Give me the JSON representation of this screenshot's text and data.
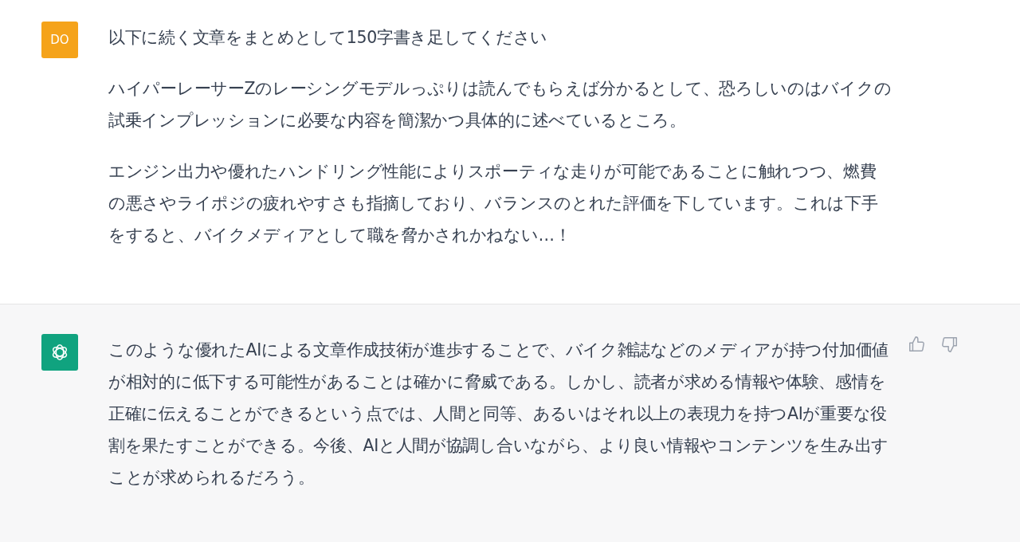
{
  "messages": [
    {
      "kind": "user",
      "avatar": "DO",
      "paragraphs": [
        "以下に続く文章をまとめとして150字書き足してください",
        "ハイパーレーサーZのレーシングモデルっぷりは読んでもらえば分かるとして、恐ろしいのはバイクの試乗インプレッションに必要な内容を簡潔かつ具体的に述べているところ。",
        "エンジン出力や優れたハンドリング性能によりスポーティな走りが可能であることに触れつつ、燃費の悪さやライポジの疲れやすさも指摘しており、バランスのとれた評価を下しています。これは下手をすると、バイクメディアとして職を脅かされかねない…！"
      ]
    },
    {
      "kind": "assistant",
      "paragraphs": [
        "このような優れたAIによる文章作成技術が進歩することで、バイク雑誌などのメディアが持つ付加価値が相対的に低下する可能性があることは確かに脅威である。しかし、読者が求める情報や体験、感情を正確に伝えることができるという点では、人間と同等、あるいはそれ以上の表現力を持つAIが重要な役割を果たすことができる。今後、AIと人間が協調し合いながら、より良い情報やコンテンツを生み出すことが求められるだろう。"
      ]
    }
  ]
}
